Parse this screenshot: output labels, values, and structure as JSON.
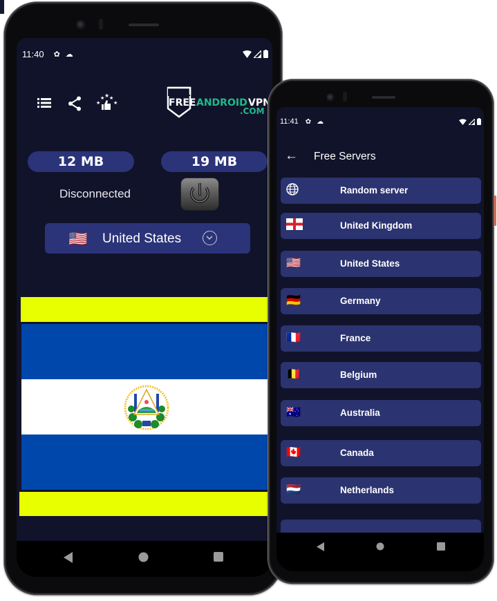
{
  "left_phone": {
    "status_bar": {
      "time": "11:40",
      "icons": [
        "gear-icon",
        "cloud-icon"
      ],
      "right_icons": [
        "wifi-icon",
        "signal-icon",
        "battery-icon"
      ]
    },
    "toolbar": {
      "icons": [
        "list-icon",
        "share-icon",
        "rate-stars-thumb-icon"
      ]
    },
    "logo": {
      "free": "FREE",
      "android": "ANDROID",
      "vpn": "VPN",
      "com": ".COM"
    },
    "stats": {
      "download": "12 MB",
      "upload": "19 MB"
    },
    "connection_status": "Disconnected",
    "selected_country": {
      "flag": "🇺🇸",
      "name": "United States"
    },
    "flag_banner": {
      "colors": {
        "yellow": "#e8ff00",
        "blue": "#0047ab",
        "white": "#ffffff"
      },
      "emblem_text": "REPUBLICA DE EL SALVADOR EN LA AMERICA CENTRAL"
    }
  },
  "right_phone": {
    "status_bar": {
      "time": "11:41",
      "icons": [
        "gear-icon",
        "cloud-icon"
      ],
      "right_icons": [
        "wifi-icon",
        "signal-icon",
        "battery-icon"
      ]
    },
    "header": {
      "title": "Free Servers"
    },
    "servers": [
      {
        "flag": "🌐",
        "name": "Random server"
      },
      {
        "flag": "🏴",
        "name": "United Kingdom"
      },
      {
        "flag": "🇺🇸",
        "name": "United States"
      },
      {
        "flag": "🇩🇪",
        "name": "Germany"
      },
      {
        "flag": "🇫🇷",
        "name": "France"
      },
      {
        "flag": "🇧🇪",
        "name": "Belgium"
      },
      {
        "flag": "🇦🇺",
        "name": "Australia"
      },
      {
        "flag": "🇨🇦",
        "name": "Canada"
      },
      {
        "flag": "🇳🇱",
        "name": "Netherlands"
      },
      {
        "flag": "",
        "name": ""
      }
    ]
  },
  "colors": {
    "screen_bg": "#11132a",
    "accent": "#2b3379",
    "logo_green": "#1fb98a"
  }
}
